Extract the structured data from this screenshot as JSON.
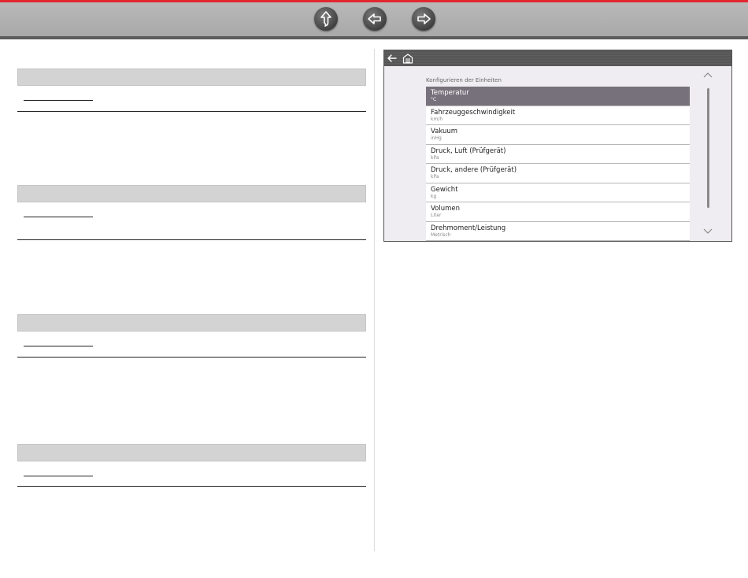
{
  "nav": {
    "home_icon": "up-arrow-icon",
    "back_icon": "left-arrow-icon",
    "forward_icon": "right-arrow-icon",
    "accent_color": "#e2262f"
  },
  "device": {
    "header": {
      "back_icon": "back-arrow-icon",
      "home_icon": "garage-home-icon"
    },
    "units_title": "Konfigurieren der Einheiten",
    "items": [
      {
        "name": "Temperatur",
        "unit": "°C",
        "selected": true
      },
      {
        "name": "Fahrzeuggeschwindigkeit",
        "unit": "km/h"
      },
      {
        "name": "Vakuum",
        "unit": "inHg"
      },
      {
        "name": "Druck, Luft (Prüfgerät)",
        "unit": "kPa"
      },
      {
        "name": "Druck, andere (Prüfgerät)",
        "unit": "kPa"
      },
      {
        "name": "Gewicht",
        "unit": "kg"
      },
      {
        "name": "Volumen",
        "unit": "Liter"
      },
      {
        "name": "Drehmoment/Leistung",
        "unit": "Metrisch"
      }
    ]
  }
}
